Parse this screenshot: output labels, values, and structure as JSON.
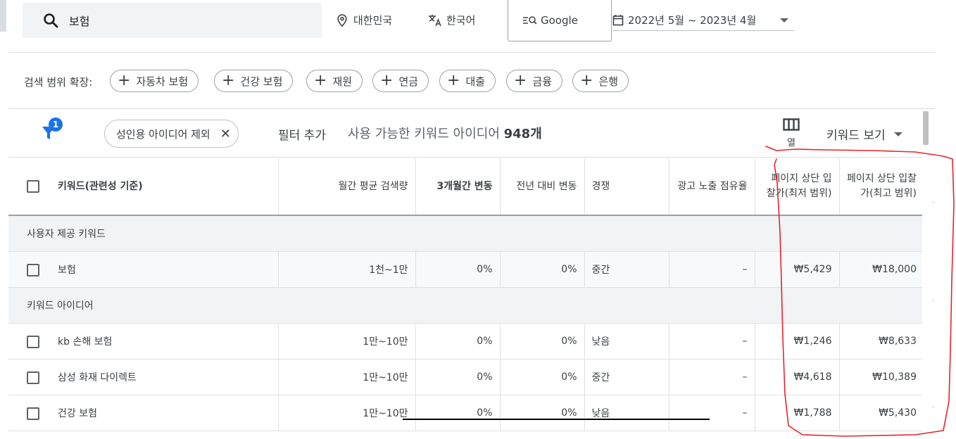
{
  "search": {
    "query": "보험"
  },
  "location": {
    "label": "대한민국"
  },
  "language": {
    "label": "한국어"
  },
  "network": {
    "label": "Google"
  },
  "date_range": {
    "label": "2022년 5월 ~ 2023년 4월"
  },
  "broaden": {
    "label": "검색 범위 확장:",
    "chips": [
      "자동차 보험",
      "건강 보험",
      "재원",
      "연금",
      "대출",
      "금융",
      "은행"
    ]
  },
  "filters": {
    "badge_count": "1",
    "active_chip": "성인용 아이디어 제외",
    "add_filter": "필터 추가",
    "count_prefix": "사용 가능한 키워드 아이디어",
    "count_value": "948개",
    "columns_label": "열",
    "view_label": "키워드 보기"
  },
  "table": {
    "headers": {
      "keyword": "키워드(관련성 기준)",
      "monthly": "월간 평균 검색량",
      "three_month": "3개월간 변동",
      "yoy": "전년 대비 변동",
      "competition": "경쟁",
      "impression_share": "광고 노출 점유율",
      "bid_low": "페이지 상단 입찰가(최저 범위)",
      "bid_high": "페이지 상단 입찰가(최고 범위)"
    },
    "group_user": "사용자 제공 키워드",
    "group_ideas": "키워드 아이디어",
    "user_rows": [
      {
        "keyword": "보험",
        "monthly": "1천~1만",
        "three_month": "0%",
        "yoy": "0%",
        "competition": "중간",
        "share": "–",
        "low": "₩5,429",
        "high": "₩18,000"
      }
    ],
    "idea_rows": [
      {
        "keyword": "kb 손해 보험",
        "monthly": "1만~10만",
        "three_month": "0%",
        "yoy": "0%",
        "competition": "낮음",
        "share": "–",
        "low": "₩1,246",
        "high": "₩8,633"
      },
      {
        "keyword": "삼성 화재 다이렉트",
        "monthly": "1만~10만",
        "three_month": "0%",
        "yoy": "0%",
        "competition": "중간",
        "share": "–",
        "low": "₩4,618",
        "high": "₩10,389"
      },
      {
        "keyword": "건강 보험",
        "monthly": "1만~10만",
        "three_month": "0%",
        "yoy": "0%",
        "competition": "낮음",
        "share": "–",
        "low": "₩1,788",
        "high": "₩5,430"
      }
    ]
  },
  "colors": {
    "accent": "#1a73e8",
    "annotation": "#e8232a"
  }
}
